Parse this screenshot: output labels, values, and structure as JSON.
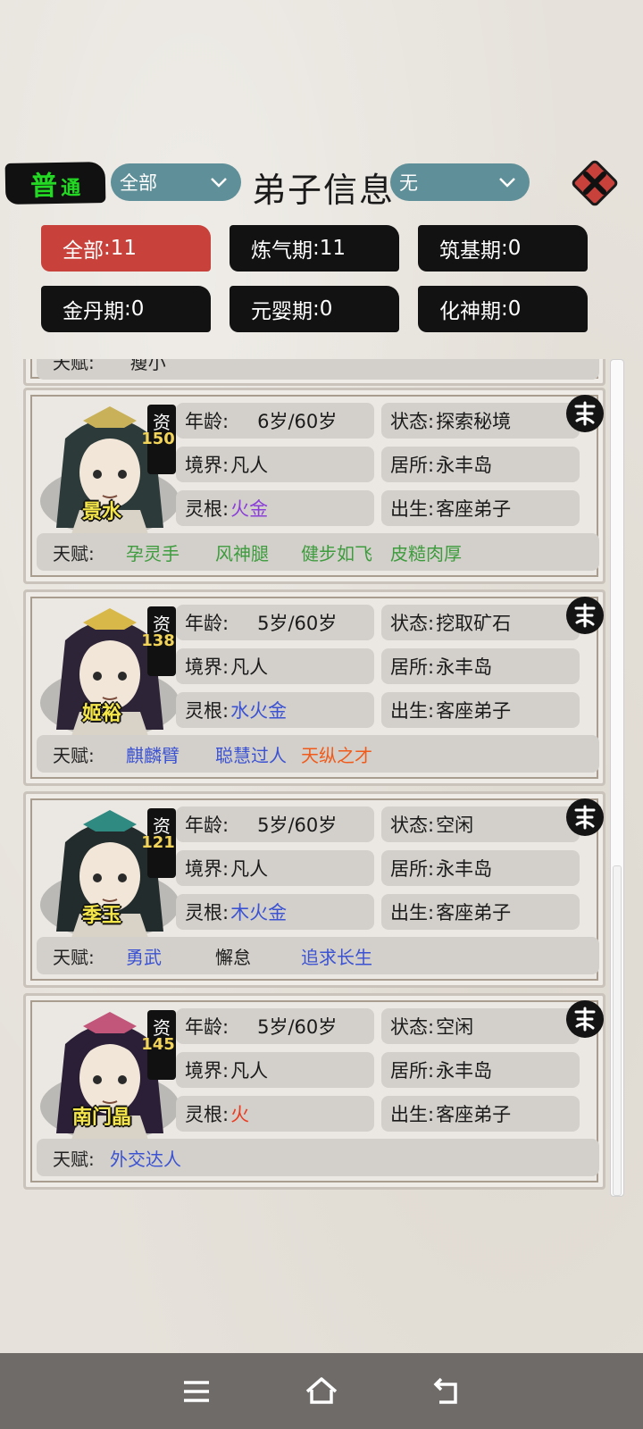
{
  "header": {
    "mode_main": "普",
    "mode_sub": "通",
    "filter_left": "全部",
    "title": "弟子信息",
    "filter_right": "无"
  },
  "realms": [
    {
      "label": "全部",
      "count": "11",
      "active": true
    },
    {
      "label": "炼气期",
      "count": "11",
      "active": false
    },
    {
      "label": "筑基期",
      "count": "0",
      "active": false
    },
    {
      "label": "金丹期",
      "count": "0",
      "active": false
    },
    {
      "label": "元婴期",
      "count": "0",
      "active": false
    },
    {
      "label": "化神期",
      "count": "0",
      "active": false
    }
  ],
  "labels": {
    "zi": "资",
    "age": "年龄:",
    "realm": "境界:",
    "root": "灵根:",
    "status": "状态:",
    "residence": "居所:",
    "birth": "出生:",
    "talent": "天赋:"
  },
  "partial_card": {
    "talent_label": "天赋:",
    "talent_fragment": "瘦小"
  },
  "disciples": [
    {
      "name": "景水",
      "aptitude": "150",
      "age": "6岁/60岁",
      "realm": "凡人",
      "root": "火金",
      "root_color": "#8b3fd8",
      "status": "探索秘境",
      "residence": "永丰岛",
      "birth": "客座弟子",
      "talents": [
        {
          "text": "孕灵手",
          "color": "#3e9b3e"
        },
        {
          "text": "风神腿",
          "color": "#3e9b3e"
        },
        {
          "text": "健步如飞",
          "color": "#3e9b3e"
        },
        {
          "text": "皮糙肉厚",
          "color": "#3e9b3e"
        }
      ]
    },
    {
      "name": "姬裕",
      "aptitude": "138",
      "age": "5岁/60岁",
      "realm": "凡人",
      "root": "水火金",
      "root_color": "#3b52d2",
      "status": "挖取矿石",
      "residence": "永丰岛",
      "birth": "客座弟子",
      "talents": [
        {
          "text": "麒麟臂",
          "color": "#3b52d2"
        },
        {
          "text": "聪慧过人",
          "color": "#3b52d2"
        },
        {
          "text": "天纵之才",
          "color": "#f05a1a"
        }
      ]
    },
    {
      "name": "季玉",
      "aptitude": "121",
      "age": "5岁/60岁",
      "realm": "凡人",
      "root": "木火金",
      "root_color": "#3b52d2",
      "status": "空闲",
      "residence": "永丰岛",
      "birth": "客座弟子",
      "talents": [
        {
          "text": "勇武",
          "color": "#3b52d2"
        },
        {
          "text": "懈怠",
          "color": "#1a1a1a"
        },
        {
          "text": "追求长生",
          "color": "#3b52d2"
        }
      ]
    },
    {
      "name": "南门晶",
      "aptitude": "145",
      "age": "5岁/60岁",
      "realm": "凡人",
      "root": "火",
      "root_color": "#ea3b21",
      "status": "空闲",
      "residence": "永丰岛",
      "birth": "客座弟子",
      "talents": [
        {
          "text": "外交达人",
          "color": "#3b52d2"
        }
      ]
    }
  ],
  "colors": {
    "accent_red": "#c8423b",
    "dropdown_teal": "#5f8f98",
    "mode_green": "#23d923",
    "aptitude_gold": "#f2d45a",
    "name_yellow": "#f4e64a"
  },
  "icons": [
    "close-icon",
    "seal-icon",
    "menu-icon",
    "home-icon",
    "back-icon",
    "chevron-down-icon"
  ]
}
